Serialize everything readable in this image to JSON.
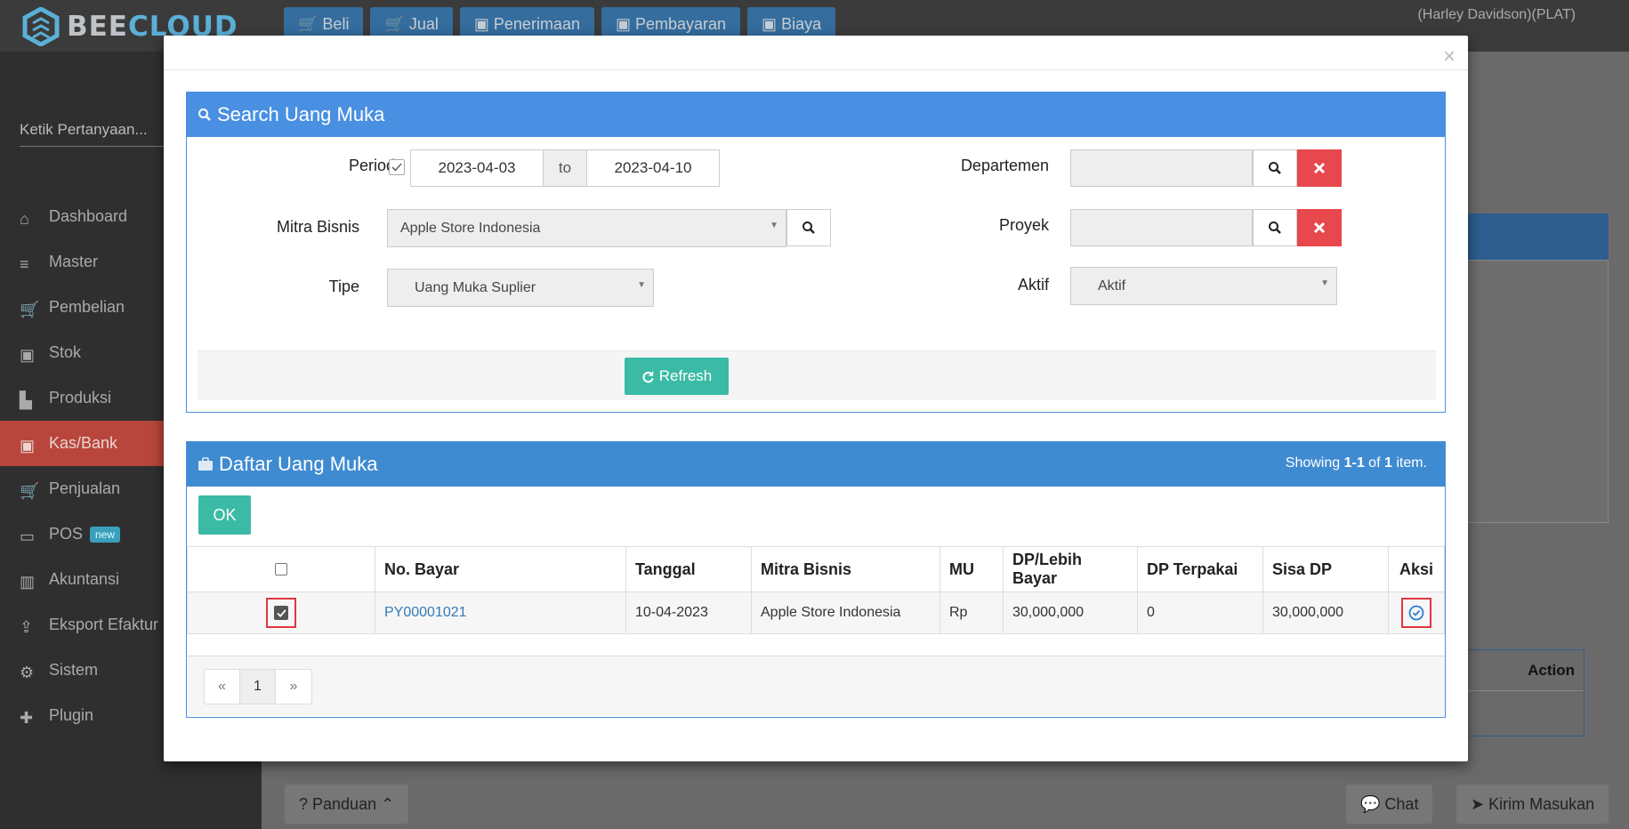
{
  "app": {
    "brand_a": "BEE",
    "brand_b": "CLOUD",
    "topnav": [
      {
        "label": "Beli"
      },
      {
        "label": "Jual"
      },
      {
        "label": "Penerimaan"
      },
      {
        "label": "Pembayaran"
      },
      {
        "label": "Biaya"
      }
    ],
    "user": "(Harley Davidson)(PLAT)",
    "ask_placeholder": "Ketik Pertanyaan...",
    "sidebar": [
      {
        "label": "Dashboard"
      },
      {
        "label": "Master"
      },
      {
        "label": "Pembelian"
      },
      {
        "label": "Stok"
      },
      {
        "label": "Produksi"
      },
      {
        "label": "Kas/Bank"
      },
      {
        "label": "Penjualan"
      },
      {
        "label": "POS",
        "badge": "new"
      },
      {
        "label": "Akuntansi"
      },
      {
        "label": "Eksport Efaktur"
      },
      {
        "label": "Sistem"
      },
      {
        "label": "Plugin"
      }
    ],
    "bg_action_header": "Action",
    "bottom": {
      "panduan": "Panduan",
      "chat": "Chat",
      "kirim": "Kirim Masukan"
    }
  },
  "search": {
    "title": "Search Uang Muka",
    "periode_label": "Periode",
    "date_from": "2023-04-03",
    "date_to_sep": "to",
    "date_to": "2023-04-10",
    "mitra_label": "Mitra Bisnis",
    "mitra_value": "Apple Store Indonesia",
    "tipe_label": "Tipe",
    "tipe_value": "Uang Muka Suplier",
    "departemen_label": "Departemen",
    "proyek_label": "Proyek",
    "aktif_label": "Aktif",
    "aktif_value": "Aktif",
    "refresh_label": "Refresh"
  },
  "list": {
    "title": "Daftar Uang Muka",
    "showing_pre": "Showing ",
    "showing_range": "1-1",
    "showing_mid": " of ",
    "showing_total": "1",
    "showing_post": " item.",
    "ok_label": "OK",
    "columns": [
      "No. Bayar",
      "Tanggal",
      "Mitra Bisnis",
      "MU",
      "DP/Lebih Bayar",
      "DP Terpakai",
      "Sisa DP",
      "Aksi"
    ],
    "rows": [
      {
        "no_bayar": "PY00001021",
        "tanggal": "10-04-2023",
        "mitra": "Apple Store Indonesia",
        "mu": "Rp",
        "dp": "30,000,000",
        "terpakai": "0",
        "sisa": "30,000,000"
      }
    ],
    "pager": {
      "prev": "«",
      "page": "1",
      "next": "»"
    }
  }
}
